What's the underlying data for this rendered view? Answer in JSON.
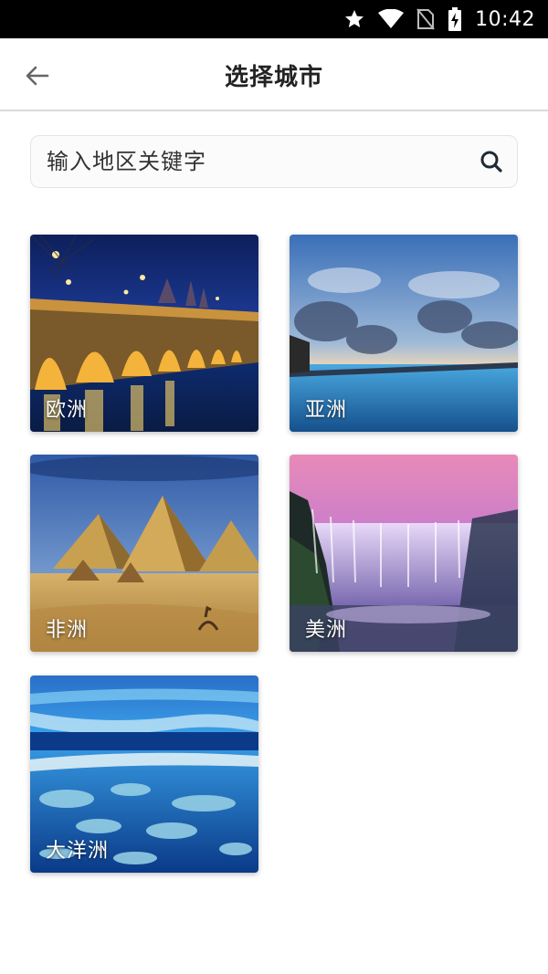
{
  "status_bar": {
    "time": "10:42",
    "icons": [
      "star-icon",
      "wifi-icon",
      "no-sim-icon",
      "battery-charging-icon"
    ]
  },
  "app_bar": {
    "back_icon": "arrow-left-icon",
    "title": "选择城市"
  },
  "search": {
    "placeholder": "输入地区关键字",
    "icon": "search-icon"
  },
  "regions": [
    {
      "label": "欧洲"
    },
    {
      "label": "亚洲"
    },
    {
      "label": "非洲"
    },
    {
      "label": "美洲"
    },
    {
      "label": "大洋洲"
    }
  ],
  "colors": {
    "status_bar_bg": "#000000",
    "title_text": "#222222",
    "divider": "#d9d9d9",
    "search_border": "#e2e4e8"
  }
}
